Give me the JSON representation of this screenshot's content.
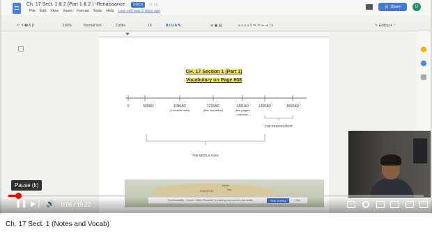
{
  "player": {
    "pause_tooltip": "Pause (k)",
    "time_current": "0:06",
    "time_separator": " / ",
    "time_total": "15:22",
    "progress_fraction": 0.0065,
    "accent_color": "#ff0000"
  },
  "video": {
    "title": "Ch. 17 Sect. 1 (Notes and Vocab)"
  },
  "docs": {
    "title": "Ch. 17 Sect. 1 & 2 (Part 1 & 2 ) -Renaissance",
    "badge": "DOCX",
    "menu": [
      "File",
      "Edit",
      "View",
      "Insert",
      "Format",
      "Tools",
      "Help"
    ],
    "last_edit": "Last edit was 2 days ago",
    "share_label": "Share",
    "avatar_initial": "U",
    "editing_label": "Editing",
    "toolbar": {
      "zoom": "100%",
      "style": "Normal text",
      "font": "Calibri",
      "size": "18"
    },
    "heading_line1": "CH. 17 Section 1 (Part 1)",
    "heading_line2": "Vocabulary on Page 608",
    "highlight_color": "#f5ee3a"
  },
  "timeline": {
    "ticks": [
      {
        "label": "0",
        "sub": ""
      },
      {
        "label": "500AD",
        "sub": ""
      },
      {
        "label": "1096AD",
        "sub": "(Crusades start)"
      },
      {
        "label": "1233AD",
        "sub": "(first Inquisition)"
      },
      {
        "label": "1331AD",
        "sub": "(first plague"
      },
      {
        "label": "1350AD",
        "sub": ""
      },
      {
        "label": "1550AD",
        "sub": ""
      }
    ],
    "plague_sub2": "outbreak)",
    "renaissance_label": "THE RENAISSANCE",
    "middle_ages_label": "THE MIDDLE AGES"
  },
  "map": {
    "label_north": "North",
    "label_sea": "Sea",
    "label_kingdom": "KINGDOM"
  },
  "screen_share": {
    "message": "Screencastify - Screen Video Recorder is sharing your screen and audio.",
    "stop_label": "Stop sharing",
    "hide_label": "Hide"
  }
}
